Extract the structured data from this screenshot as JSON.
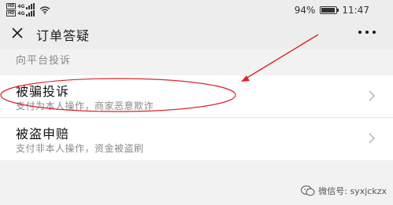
{
  "status_bar": {
    "hd_label": "HD",
    "net_label_1": "4G",
    "net_label_2": "4G",
    "battery_text": "94%",
    "battery_level": 0.94,
    "time": "11:47"
  },
  "title_bar": {
    "title": "订单答疑",
    "close_icon": "close-icon",
    "more_icon": "more-icon"
  },
  "section": {
    "header": "向平台投诉"
  },
  "items": [
    {
      "title": "被骗投诉",
      "subtitle": "支付为本人操作，商家恶意欺诈"
    },
    {
      "title": "被盗申赔",
      "subtitle": "支付非本人操作，资金被盗刷"
    }
  ],
  "annotation": {
    "color": "#d9262b"
  },
  "watermark": {
    "text": "微信号: syxjckzx",
    "icon": "wechat-icon"
  }
}
